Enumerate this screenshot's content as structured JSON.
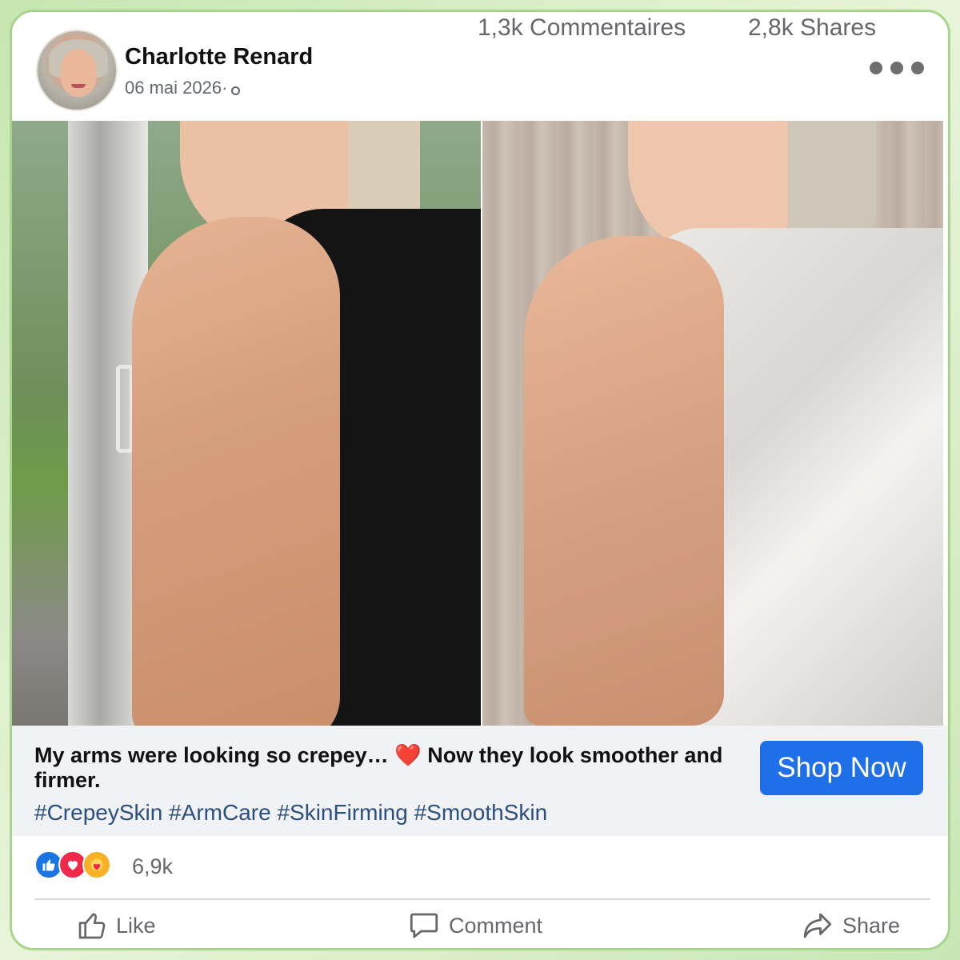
{
  "post": {
    "author": "Charlotte Renard",
    "date": "06 mai 2026·",
    "caption_before_emoji": "My arms were looking so crepey… ",
    "caption_emoji": "❤️",
    "caption_after_emoji": " Now they look smoother and firmer.",
    "hashtags": "#CrepeySkin #ArmCare #SkinFirming #SmoothSkin",
    "shop_button": "Shop Now"
  },
  "stats": {
    "reactions": "6,9k",
    "comments": "1,3k Commentaires",
    "shares": "2,8k Shares"
  },
  "actions": {
    "like": "Like",
    "comment": "Comment",
    "share": "Share"
  },
  "icons": {
    "more": "more-options-icon",
    "privacy": "globe-icon",
    "reactions": [
      "like-reaction-icon",
      "love-reaction-icon",
      "care-reaction-icon"
    ]
  },
  "colors": {
    "accent": "#1f6fe8",
    "hashtag": "#2b4f7f",
    "frame": "#a7d58c"
  }
}
